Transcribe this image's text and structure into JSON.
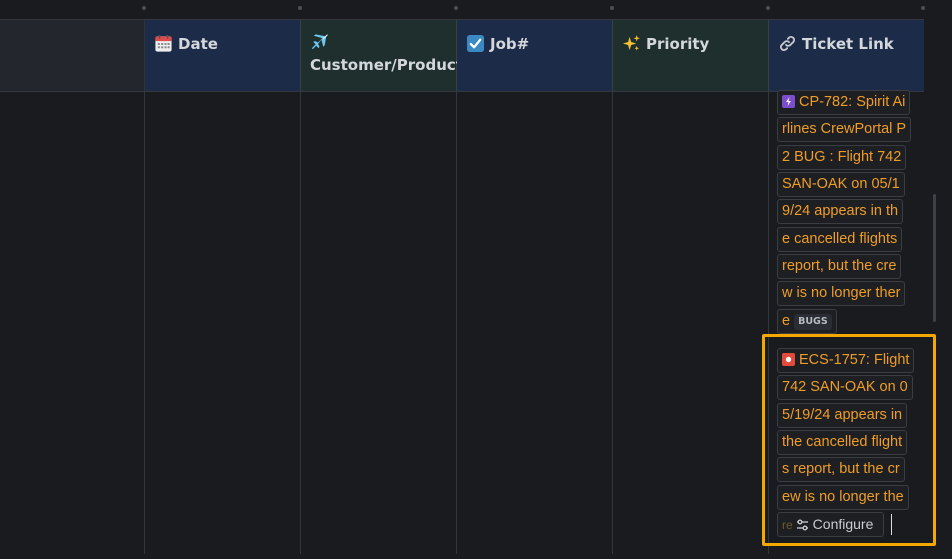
{
  "columns": [
    {
      "label": "",
      "icon": "none"
    },
    {
      "label": "Date",
      "icon": "calendar-icon"
    },
    {
      "label": "Customer/Product",
      "icon": "airplane-icon"
    },
    {
      "label": "Job#",
      "icon": "checkbox-icon"
    },
    {
      "label": "Priority",
      "icon": "sparkles-icon"
    },
    {
      "label": "Ticket Link",
      "icon": "link-icon"
    }
  ],
  "tickets": [
    {
      "id": "CP-782",
      "icon": "lightning-icon",
      "icon_color": "#7c4dcc",
      "lines": [
        "CP-782: Spirit Ai",
        "rlines CrewPortal P",
        "2 BUG : Flight 742",
        "SAN-OAK on 05/1",
        "9/24 appears in th",
        "e cancelled flights",
        "report, but the cre",
        "w is no longer ther",
        "e"
      ],
      "tag": "BUGS"
    },
    {
      "id": "ECS-1757",
      "icon": "record-icon",
      "icon_color": "#e5493a",
      "lines": [
        "ECS-1757: Flight",
        "742 SAN-OAK on 0",
        "5/19/24 appears in",
        "the cancelled flight",
        "s report, but the cr",
        "ew is no longer the",
        "re"
      ]
    }
  ],
  "configure_label": "Configure",
  "colors": {
    "link_text": "#ef9d27",
    "highlight": "#f5a800",
    "header_blue": "#1c2b48",
    "header_teal": "#1f2f2e",
    "background": "#191b1f"
  }
}
